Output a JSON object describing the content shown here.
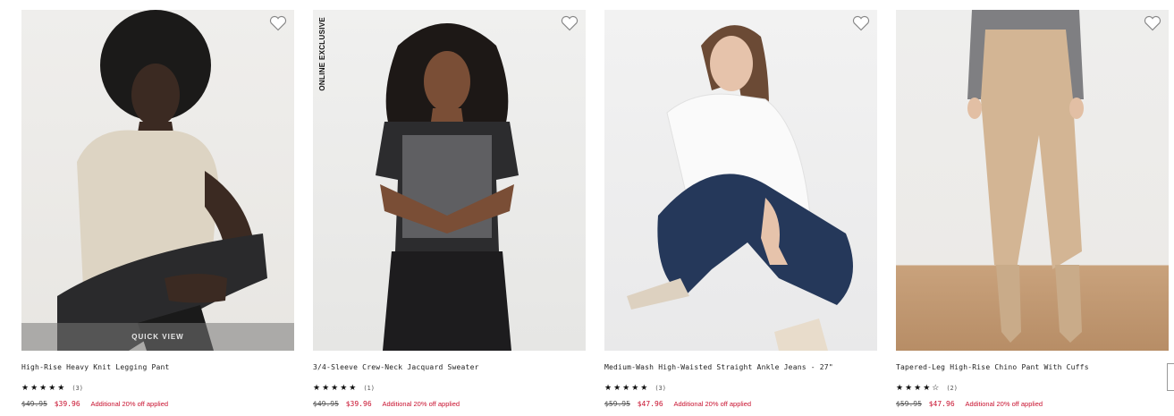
{
  "products": [
    {
      "name": "High-Rise Heavy Knit Legging Pant",
      "stars": "★★★★★",
      "review_count": "(3)",
      "original_price": "$49.95",
      "sale_price": "$39.96",
      "promo": "Additional 20% off applied",
      "quick_view": "QUICK VIEW",
      "badge": ""
    },
    {
      "name": "3/4-Sleeve Crew-Neck Jacquard Sweater",
      "stars": "★★★★★",
      "review_count": "(1)",
      "original_price": "$49.95",
      "sale_price": "$39.96",
      "promo": "Additional 20% off applied",
      "badge": "ONLINE EXCLUSIVE"
    },
    {
      "name": "Medium-Wash High-Waisted Straight Ankle Jeans - 27\"",
      "stars": "★★★★★",
      "review_count": "(3)",
      "original_price": "$59.95",
      "sale_price": "$47.96",
      "promo": "Additional 20% off applied",
      "badge": ""
    },
    {
      "name": "Tapered-Leg High-Rise Chino Pant With Cuffs",
      "stars": "★★★★☆",
      "review_count": "(2)",
      "original_price": "$59.95",
      "sale_price": "$47.96",
      "promo": "Additional 20% off applied",
      "badge": ""
    }
  ],
  "icons": {
    "wishlist": "heart-outline-icon",
    "rating": "star-icon"
  },
  "colors": {
    "sale": "#c8102e",
    "text": "#222222"
  }
}
